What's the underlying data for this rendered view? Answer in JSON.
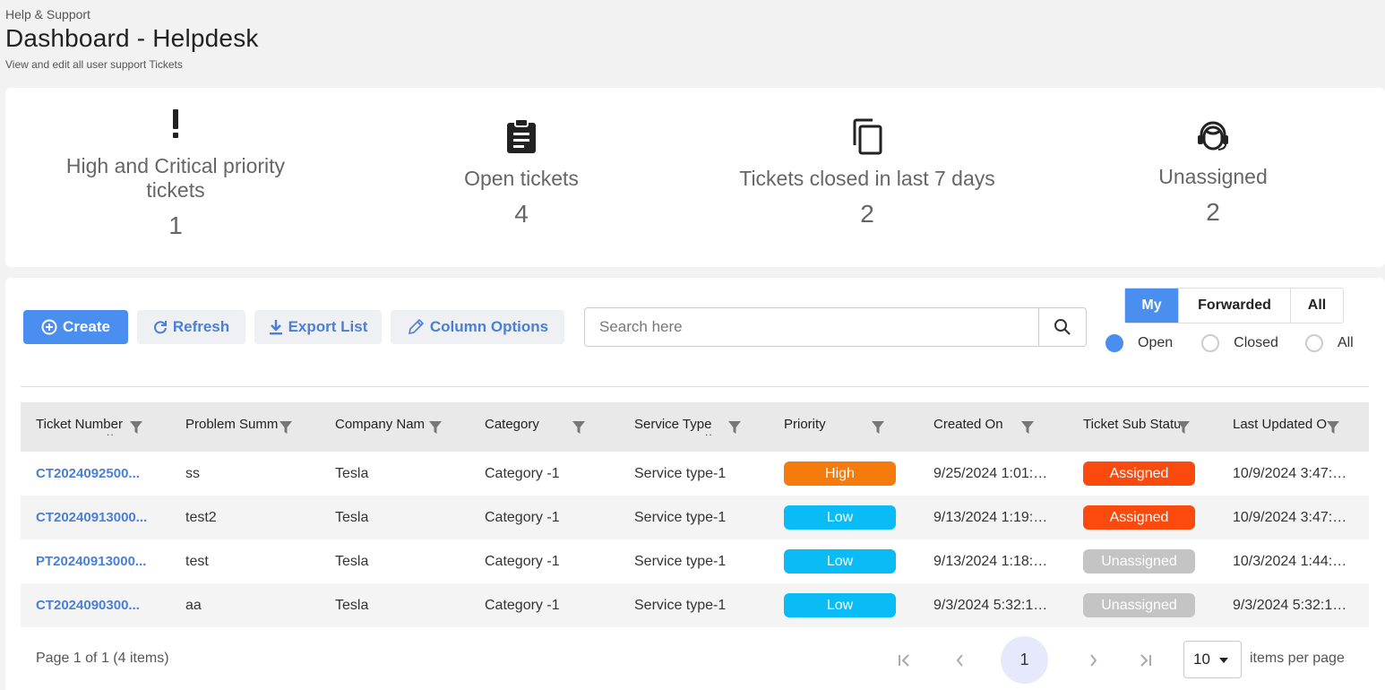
{
  "header": {
    "breadcrumb": "Help & Support",
    "title": "Dashboard - Helpdesk",
    "subtitle": "View and edit all user support Tickets"
  },
  "stats": [
    {
      "icon": "exclamation-icon",
      "label": "High and Critical priority tickets",
      "value": "1"
    },
    {
      "icon": "clipboard-icon",
      "label": "Open tickets",
      "value": "4"
    },
    {
      "icon": "copy-icon",
      "label": "Tickets closed in last 7 days",
      "value": "2"
    },
    {
      "icon": "headset-icon",
      "label": "Unassigned",
      "value": "2"
    }
  ],
  "toolbar": {
    "create_label": "Create",
    "refresh_label": "Refresh",
    "export_label": "Export List",
    "columns_label": "Column Options",
    "search_placeholder": "Search here"
  },
  "filter_tabs": [
    "My",
    "Forwarded",
    "All"
  ],
  "active_filter_tab": "My",
  "status_filters": [
    "Open",
    "Closed",
    "All"
  ],
  "active_status_filter": "Open",
  "table": {
    "columns": [
      "Ticket Number",
      "Problem Summ",
      "Company Nam",
      "Category",
      "Service Type",
      "Priority",
      "Created On",
      "Ticket Sub Statu",
      "Last Updated O"
    ],
    "rows": [
      {
        "ticket": "CT2024092500...",
        "summary": "ss",
        "company": "Tesla",
        "category": "Category -1",
        "service": "Service type-1",
        "priority": "High",
        "created": "9/25/2024 1:01:4...",
        "status": "Assigned",
        "updated": "10/9/2024 3:47:0..."
      },
      {
        "ticket": "CT20240913000...",
        "summary": "test2",
        "company": "Tesla",
        "category": "Category -1",
        "service": "Service type-1",
        "priority": "Low",
        "created": "9/13/2024 1:19:38...",
        "status": "Assigned",
        "updated": "10/9/2024 3:47:2..."
      },
      {
        "ticket": "PT20240913000...",
        "summary": "test",
        "company": "Tesla",
        "category": "Category -1",
        "service": "Service type-1",
        "priority": "Low",
        "created": "9/13/2024 1:18:48...",
        "status": "Unassigned",
        "updated": "10/3/2024 1:44:15..."
      },
      {
        "ticket": "CT2024090300...",
        "summary": "aa",
        "company": "Tesla",
        "category": "Category -1",
        "service": "Service type-1",
        "priority": "Low",
        "created": "9/3/2024 5:32:10...",
        "status": "Unassigned",
        "updated": "9/3/2024 5:32:10..."
      }
    ]
  },
  "pagination": {
    "info": "Page 1 of 1 (4 items)",
    "current_page": "1",
    "page_size": "10",
    "page_size_label": "items per page"
  },
  "colors": {
    "accent": "#4a8ff0",
    "link": "#4a7fd8",
    "priority_high": "#f57c0c",
    "priority_low": "#0abcf5",
    "status_assigned": "#fa4a0e",
    "status_unassigned": "#c4c4c4"
  }
}
